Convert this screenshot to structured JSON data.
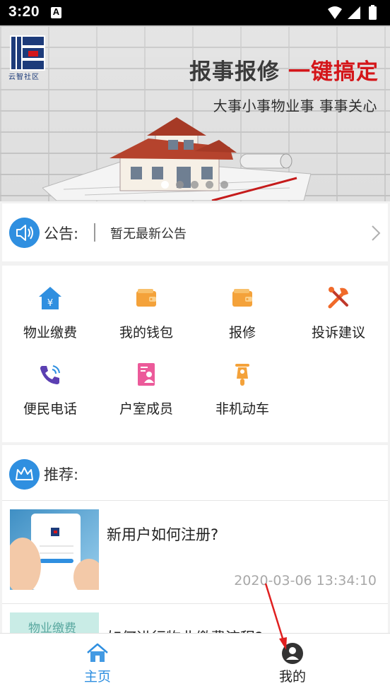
{
  "status_bar": {
    "time": "3:20",
    "notification_icon": "A"
  },
  "banner": {
    "logo_text": "云智社区",
    "title_part1": "报事报修",
    "title_part2": "一键搞定",
    "subtitle": "大事小事物业事   事事关心",
    "page_dots": 5,
    "active_dot": 0
  },
  "notice": {
    "label": "公告:",
    "text": "暂无最新公告",
    "icon": "speaker-icon"
  },
  "services": [
    {
      "label": "物业缴费",
      "icon": "house-fee-icon",
      "color": "#2f8fe0"
    },
    {
      "label": "我的钱包",
      "icon": "wallet-icon",
      "color": "#f4a23a"
    },
    {
      "label": "报修",
      "icon": "wallet-repair-icon",
      "color": "#f4a23a"
    },
    {
      "label": "投诉建议",
      "icon": "tools-icon",
      "color": "#f06a2a"
    },
    {
      "label": "便民电话",
      "icon": "phone-icon",
      "color": "#5b3fb2"
    },
    {
      "label": "户室成员",
      "icon": "member-card-icon",
      "color": "#ec5a9a"
    },
    {
      "label": "非机动车",
      "icon": "scooter-icon",
      "color": "#f4a23a"
    }
  ],
  "recommend": {
    "title": "推荐:",
    "items": [
      {
        "title": "新用户如何注册?",
        "date": "2020-03-06 13:34:10"
      },
      {
        "title": "如何进行物业缴费流程?",
        "thumb_text": "物业缴费"
      }
    ]
  },
  "bottom_nav": {
    "home_label": "主页",
    "mine_label": "我的",
    "active_color": "#2f8fe0"
  }
}
